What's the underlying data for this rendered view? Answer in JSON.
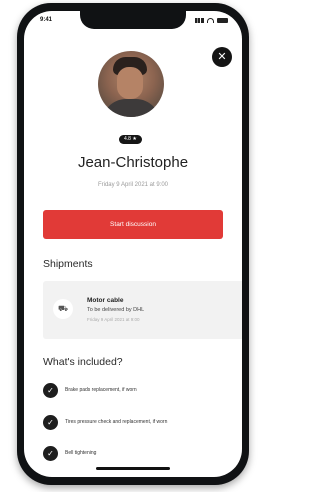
{
  "status_bar": {
    "time": "9:41"
  },
  "profile": {
    "name": "Jean-Christophe",
    "date": "Friday 9 April 2021 at 9:00",
    "badge": "4.8 ★"
  },
  "actions": {
    "start_label": "Start discussion",
    "close_icon": "close-icon"
  },
  "shipments": {
    "title": "Shipments",
    "items": [
      {
        "icon": "package-icon",
        "title": "Motor cable",
        "subtitle": "To be delivered by DHL",
        "date": "Friday 9 April 2021 at 9:00"
      }
    ]
  },
  "included": {
    "title": "What's included?",
    "items": [
      {
        "label": "Brake pads replacement, if worn"
      },
      {
        "label": "Tires pressure check and replacement, if worn"
      },
      {
        "label": "Bell tightening"
      }
    ]
  },
  "colors": {
    "accent": "#e13a37",
    "dark": "#141414"
  }
}
